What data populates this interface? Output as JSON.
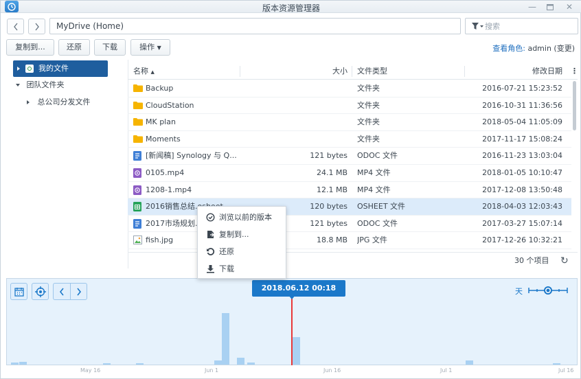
{
  "window": {
    "title": "版本资源管理器"
  },
  "toolbar": {
    "path": "MyDrive (Home)",
    "search_placeholder": "搜索",
    "copy_to": "复制到...",
    "restore": "还原",
    "download": "下载",
    "actions": "操作",
    "role_label": "查看角色:",
    "role_value": "admin (变更)"
  },
  "tree": [
    {
      "label": "我的文件"
    },
    {
      "label": "团队文件夹"
    },
    {
      "label": "总公司分发文件"
    }
  ],
  "list": {
    "columns": {
      "name": "名称",
      "size": "大小",
      "type": "文件类型",
      "modified": "修改日期"
    },
    "rows": [
      {
        "name": "Backup",
        "size": "",
        "type": "文件夹",
        "modified": "2016-07-21 15:23:52",
        "icon": "folder-icon"
      },
      {
        "name": "CloudStation",
        "size": "",
        "type": "文件夹",
        "modified": "2016-10-31 11:36:56",
        "icon": "folder-icon"
      },
      {
        "name": "MK plan",
        "size": "",
        "type": "文件夹",
        "modified": "2018-05-04 11:05:09",
        "icon": "folder-icon"
      },
      {
        "name": "Moments",
        "size": "",
        "type": "文件夹",
        "modified": "2017-11-17 15:08:24",
        "icon": "folder-icon"
      },
      {
        "name": "[新闻稿] Synology 与 Q...",
        "size": "121 bytes",
        "type": "ODOC 文件",
        "modified": "2016-11-23 13:03:04",
        "icon": "document-icon"
      },
      {
        "name": "0105.mp4",
        "size": "24.1 MB",
        "type": "MP4 文件",
        "modified": "2018-01-05 10:10:47",
        "icon": "video-icon"
      },
      {
        "name": "1208-1.mp4",
        "size": "12.1 MB",
        "type": "MP4 文件",
        "modified": "2017-12-08 13:50:48",
        "icon": "video-icon"
      },
      {
        "name": "2016销售总结.osheet",
        "size": "120 bytes",
        "type": "OSHEET 文件",
        "modified": "2018-04-03 12:03:43",
        "icon": "spreadsheet-icon"
      },
      {
        "name": "2017市场规划.odoc",
        "size": "121 bytes",
        "type": "ODOC 文件",
        "modified": "2017-03-27 15:07:14",
        "icon": "document-icon"
      },
      {
        "name": "fish.jpg",
        "size": "18.8 MB",
        "type": "JPG 文件",
        "modified": "2017-12-26 10:32:21",
        "icon": "image-icon"
      }
    ],
    "item_count": "30 个项目"
  },
  "context_menu": {
    "browse_versions": "浏览以前的版本",
    "copy_to": "复制到...",
    "restore": "还原",
    "download": "下载"
  },
  "timeline": {
    "current": "2018.06.12 00:18",
    "scale_label": "天",
    "axis": [
      "May 16",
      "Jun 1",
      "Jun 16",
      "Jul 1",
      "Jul 16"
    ]
  },
  "colors": {
    "accent": "#1b78c9",
    "cursor": "#e93838",
    "selection": "#dcebfa",
    "folder": "#f6b400"
  }
}
